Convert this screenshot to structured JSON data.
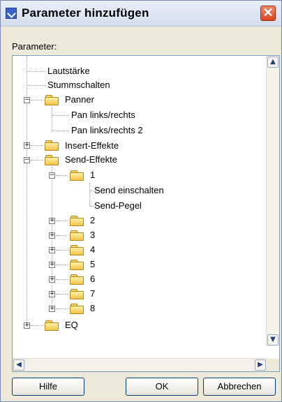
{
  "window": {
    "title": "Parameter hinzufügen",
    "close_glyph": "✕"
  },
  "param_label": "Parameter:",
  "tree": {
    "items": [
      {
        "label": "Lautstärke"
      },
      {
        "label": "Stummschalten"
      },
      {
        "label": "Panner",
        "icon": "folder-icon",
        "expanded": true
      },
      {
        "label": "Pan links/rechts"
      },
      {
        "label": "Pan links/rechts 2"
      },
      {
        "label": "Insert-Effekte",
        "icon": "folder-icon",
        "expanded": false
      },
      {
        "label": "Send-Effekte",
        "icon": "folder-icon",
        "expanded": true
      },
      {
        "label": "1",
        "icon": "folder-icon",
        "expanded": true
      },
      {
        "label": "Send einschalten"
      },
      {
        "label": "Send-Pegel"
      },
      {
        "label": "2",
        "icon": "folder-icon",
        "expanded": false
      },
      {
        "label": "3",
        "icon": "folder-icon",
        "expanded": false
      },
      {
        "label": "4",
        "icon": "folder-icon",
        "expanded": false
      },
      {
        "label": "5",
        "icon": "folder-icon",
        "expanded": false
      },
      {
        "label": "6",
        "icon": "folder-icon",
        "expanded": false
      },
      {
        "label": "7",
        "icon": "folder-icon",
        "expanded": false
      },
      {
        "label": "8",
        "icon": "folder-icon",
        "expanded": false
      },
      {
        "label": "EQ",
        "icon": "folder-icon",
        "expanded": false
      }
    ]
  },
  "scroll": {
    "up": "▲",
    "down": "▼",
    "left": "◀",
    "right": "▶"
  },
  "buttons": {
    "help": "Hilfe",
    "ok": "OK",
    "cancel": "Abbrechen"
  },
  "colors": {
    "folder": "#f2c44a",
    "selection_border": "#003c74"
  }
}
